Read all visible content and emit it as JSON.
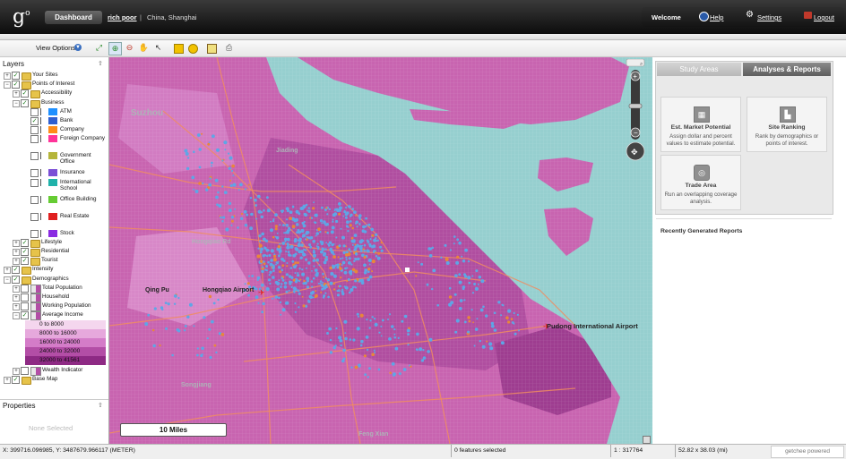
{
  "header": {
    "logo": "g",
    "logo_sup": "o",
    "dashboard_label": "Dashboard",
    "user_name": "rich poor",
    "separator": "|",
    "location": "China, Shanghai",
    "welcome": "Welcome",
    "help": "Help",
    "settings": "Settings",
    "logout": "Logout"
  },
  "toolbar": {
    "view_options": "View Options",
    "tools": [
      "select-tool-icon",
      "zoom-in-tool-icon",
      "zoom-out-tool-icon",
      "pan-tool-icon",
      "pointer-tool-icon",
      "rectangle-tool-icon",
      "circle-tool-icon",
      "identify-tool-icon",
      "print-tool-icon"
    ]
  },
  "layers": {
    "title": "Layers",
    "items": [
      {
        "label": "Your Sites",
        "level": 0,
        "checked": true,
        "type": "folder",
        "expanded": false
      },
      {
        "label": "Points of Interest",
        "level": 0,
        "checked": true,
        "type": "folder",
        "expanded": true
      },
      {
        "label": "Accessibility",
        "level": 1,
        "checked": true,
        "type": "folder",
        "expanded": false
      },
      {
        "label": "Business",
        "level": 1,
        "checked": true,
        "type": "folder",
        "expanded": true
      },
      {
        "label": "ATM",
        "level": 2,
        "checked": false,
        "type": "poi",
        "color": "#1e90ff"
      },
      {
        "label": "Bank",
        "level": 2,
        "checked": true,
        "type": "poi",
        "color": "#2f5fd0"
      },
      {
        "label": "Company",
        "level": 2,
        "checked": false,
        "type": "poi",
        "color": "#ff8c1a"
      },
      {
        "label": "Foreign Company",
        "level": 2,
        "checked": false,
        "type": "poi",
        "color": "#ff3399"
      },
      {
        "label": "Government Office",
        "level": 2,
        "checked": false,
        "type": "poi",
        "color": "#b5b53a"
      },
      {
        "label": "Insurance",
        "level": 2,
        "checked": false,
        "type": "poi",
        "color": "#7b4fd6"
      },
      {
        "label": "International School",
        "level": 2,
        "checked": false,
        "type": "poi",
        "color": "#20b2aa"
      },
      {
        "label": "Office Building",
        "level": 2,
        "checked": false,
        "type": "poi",
        "color": "#66cc33"
      },
      {
        "label": "Real Estate",
        "level": 2,
        "checked": false,
        "type": "poi",
        "color": "#e02020"
      },
      {
        "label": "Stock",
        "level": 2,
        "checked": false,
        "type": "poi",
        "color": "#8a2be2"
      },
      {
        "label": "Lifestyle",
        "level": 1,
        "checked": true,
        "type": "folder",
        "expanded": false
      },
      {
        "label": "Residential",
        "level": 1,
        "checked": true,
        "type": "folder",
        "expanded": false
      },
      {
        "label": "Tourist",
        "level": 1,
        "checked": true,
        "type": "folder",
        "expanded": false
      },
      {
        "label": "Intensity",
        "level": 0,
        "checked": true,
        "type": "folder",
        "expanded": false
      },
      {
        "label": "Demographics",
        "level": 0,
        "checked": true,
        "type": "folder",
        "expanded": true
      },
      {
        "label": "Total Population",
        "level": 1,
        "checked": false,
        "type": "layer",
        "expanded": false
      },
      {
        "label": "Household",
        "level": 1,
        "checked": false,
        "type": "layer",
        "expanded": false
      },
      {
        "label": "Working Population",
        "level": 1,
        "checked": false,
        "type": "layer",
        "expanded": false
      },
      {
        "label": "Average Income",
        "level": 1,
        "checked": true,
        "type": "layer",
        "expanded": true
      }
    ],
    "legend": [
      {
        "label": "0 to 8000",
        "color": "#f4d6ee"
      },
      {
        "label": "8000 to 16000",
        "color": "#e6a8dc"
      },
      {
        "label": "16000 to 24000",
        "color": "#d47cc8"
      },
      {
        "label": "24000 to 32000",
        "color": "#b34ea6"
      },
      {
        "label": "32000 to 41561",
        "color": "#8e2a84"
      }
    ],
    "items_after": [
      {
        "label": "Wealth Indicator",
        "level": 1,
        "checked": false,
        "type": "layer",
        "expanded": false
      },
      {
        "label": "Base Map",
        "level": 0,
        "checked": true,
        "type": "folder",
        "expanded": false
      }
    ]
  },
  "properties": {
    "title": "Properties",
    "empty": "None Selected"
  },
  "map": {
    "labels": {
      "suzhou": "Suzhou",
      "jiading": "Jiading",
      "hongqiao": "Hongqiao Airport",
      "qingpu": "Qing Pu",
      "pudong": "Pudong International Airport",
      "songjiang": "Songjiang",
      "fengxian": "Feng Xian"
    },
    "scale": "10 Miles",
    "colors": {
      "water": "#96cfcf",
      "choropleth": "#c864b0",
      "dark": "#a8479a",
      "poi": "#5ea6e6",
      "road": "#f08c60"
    }
  },
  "right": {
    "tab_study": "Study Areas",
    "tab_analyses": "Analyses & Reports",
    "cards": [
      {
        "title": "Est. Market Potential",
        "desc": "Assign dollar and percent values to estimate potential.",
        "icon": "grid-icon"
      },
      {
        "title": "Site Ranking",
        "desc": "Rank by demographics or points of interest.",
        "icon": "bar-chart-icon"
      },
      {
        "title": "Trade Area",
        "desc": "Run an overlapping coverage analysis.",
        "icon": "rings-icon"
      }
    ],
    "recent": "Recently Generated Reports"
  },
  "status": {
    "coords": "X: 399716.096985, Y: 3487679.966117 (METER)",
    "selected": "0 features selected",
    "scale": "1 : 317764",
    "area": "52.82 x 38.03 (mi)",
    "powered": "getchee powered"
  }
}
